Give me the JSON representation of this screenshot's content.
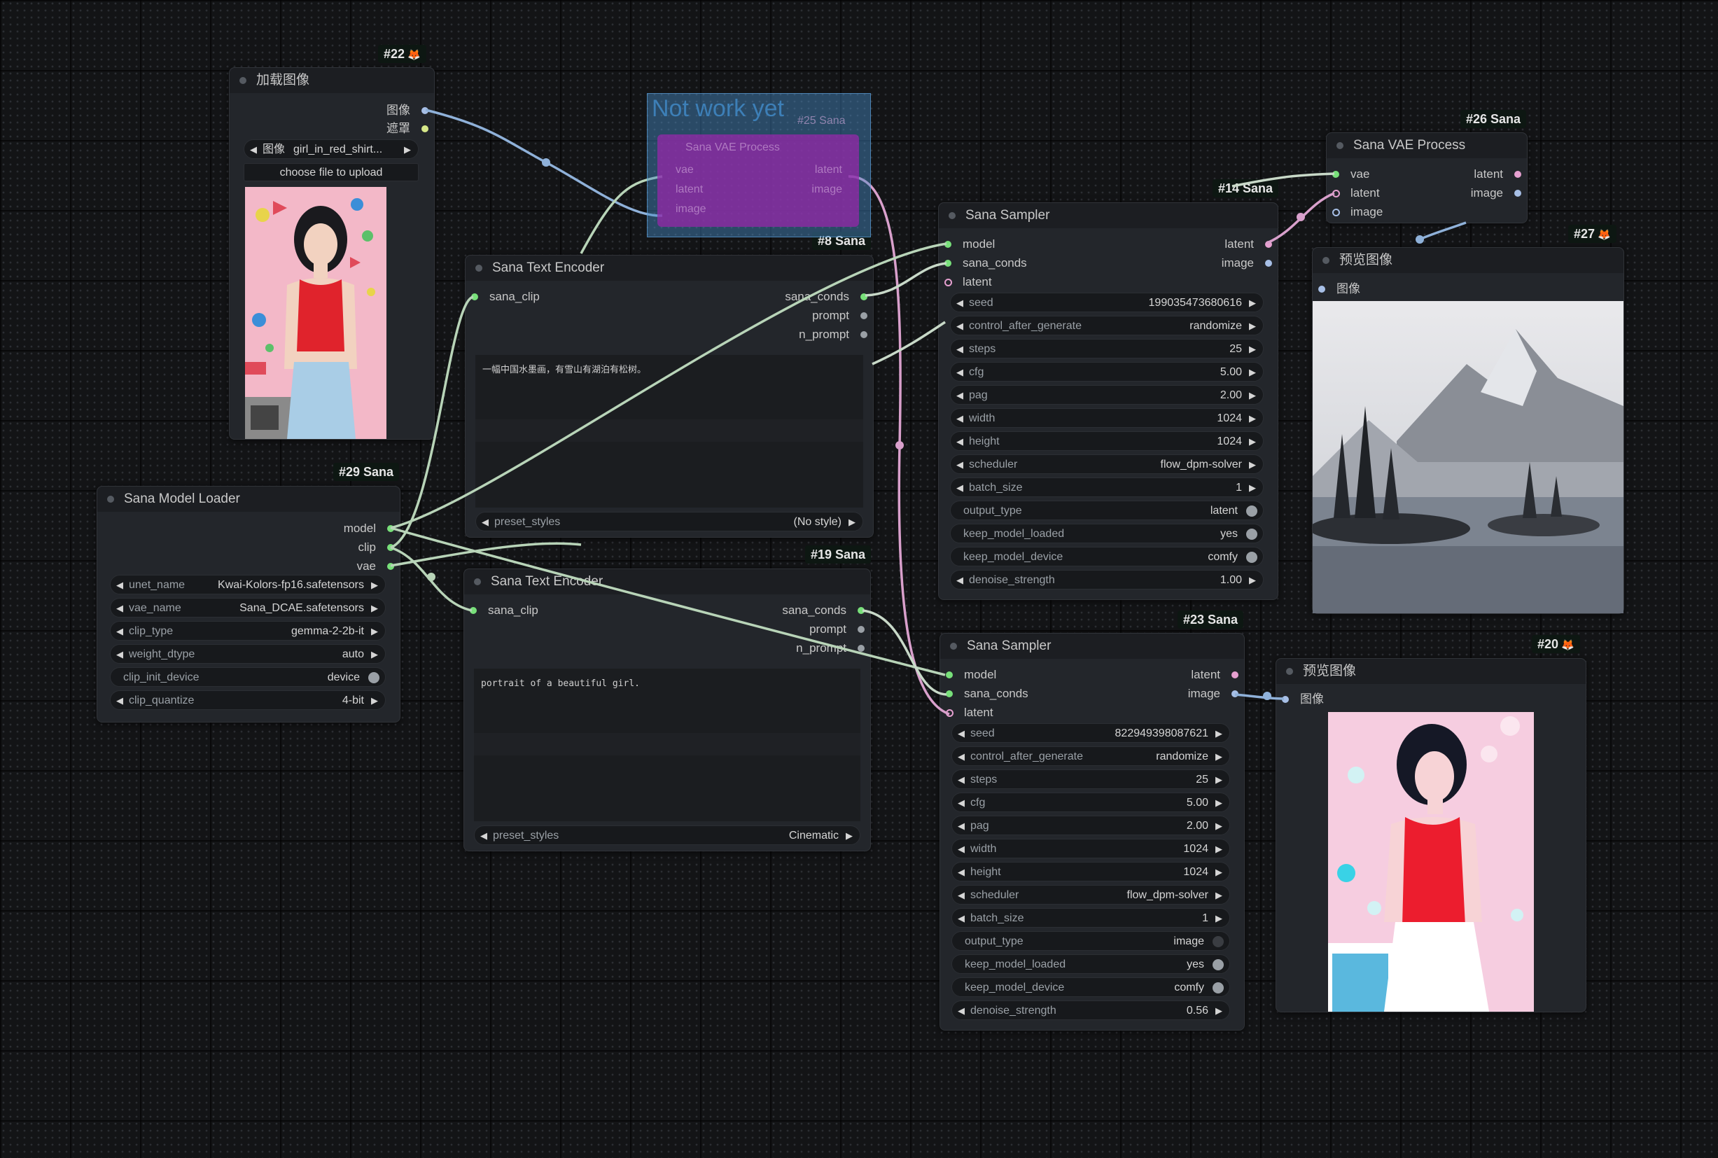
{
  "colors": {
    "clip_wire": "#b8d4b8",
    "vae_wire": "#f0e6e6",
    "image_wire": "#8fb1d9",
    "latent_wire": "#e6a0d0",
    "conds_wire": "#c8d9c8"
  },
  "icons": {
    "fox": "fox-icon",
    "arrow_left": "arrow-left-icon",
    "arrow_right": "arrow-right-icon"
  },
  "load_image": {
    "badge": "#22",
    "title": "加载图像",
    "outputs": [
      "图像",
      "遮罩"
    ],
    "image_widget": {
      "label": "图像",
      "value": "girl_in_red_shirt..."
    },
    "upload_button": "choose file to upload"
  },
  "group": {
    "title": "Not work yet",
    "badge": "#25 Sana",
    "node_title": "Sana VAE Process",
    "inputs": [
      "vae",
      "latent",
      "image"
    ],
    "outputs": [
      "latent",
      "image"
    ]
  },
  "text_encoder_1": {
    "badge": "#8 Sana",
    "title": "Sana Text Encoder",
    "input": "sana_clip",
    "outputs": [
      "sana_conds",
      "prompt",
      "n_prompt"
    ],
    "text": "一幅中国水墨画，有雪山有湖泊有松树。",
    "preset": {
      "label": "preset_styles",
      "value": "(No style)"
    }
  },
  "text_encoder_2": {
    "badge": "#19 Sana",
    "title": "Sana Text Encoder",
    "input": "sana_clip",
    "outputs": [
      "sana_conds",
      "prompt",
      "n_prompt"
    ],
    "text": "portrait of a beautiful girl.",
    "preset": {
      "label": "preset_styles",
      "value": "Cinematic"
    }
  },
  "model_loader": {
    "badge": "#29 Sana",
    "title": "Sana Model Loader",
    "outputs": [
      "model",
      "clip",
      "vae"
    ],
    "widgets": [
      {
        "label": "unet_name",
        "value": "Kwai-Kolors-fp16.safetensors",
        "kind": "combo"
      },
      {
        "label": "vae_name",
        "value": "Sana_DCAE.safetensors",
        "kind": "combo"
      },
      {
        "label": "clip_type",
        "value": "gemma-2-2b-it",
        "kind": "combo"
      },
      {
        "label": "weight_dtype",
        "value": "auto",
        "kind": "combo"
      },
      {
        "label": "clip_init_device",
        "value": "device",
        "kind": "toggle"
      },
      {
        "label": "clip_quantize",
        "value": "4-bit",
        "kind": "combo"
      }
    ]
  },
  "sampler_1": {
    "badge": "#14 Sana",
    "title": "Sana Sampler",
    "inputs": [
      "model",
      "sana_conds",
      "latent"
    ],
    "outputs": [
      "latent",
      "image"
    ],
    "widgets": [
      {
        "label": "seed",
        "value": "199035473680616",
        "kind": "num"
      },
      {
        "label": "control_after_generate",
        "value": "randomize",
        "kind": "num"
      },
      {
        "label": "steps",
        "value": "25",
        "kind": "num"
      },
      {
        "label": "cfg",
        "value": "5.00",
        "kind": "num"
      },
      {
        "label": "pag",
        "value": "2.00",
        "kind": "num"
      },
      {
        "label": "width",
        "value": "1024",
        "kind": "num"
      },
      {
        "label": "height",
        "value": "1024",
        "kind": "num"
      },
      {
        "label": "scheduler",
        "value": "flow_dpm-solver",
        "kind": "num"
      },
      {
        "label": "batch_size",
        "value": "1",
        "kind": "num"
      },
      {
        "label": "output_type",
        "value": "latent",
        "kind": "toggle"
      },
      {
        "label": "keep_model_loaded",
        "value": "yes",
        "kind": "toggle"
      },
      {
        "label": "keep_model_device",
        "value": "comfy",
        "kind": "toggle"
      },
      {
        "label": "denoise_strength",
        "value": "1.00",
        "kind": "num"
      }
    ]
  },
  "sampler_2": {
    "badge": "#23 Sana",
    "title": "Sana Sampler",
    "inputs": [
      "model",
      "sana_conds",
      "latent"
    ],
    "outputs": [
      "latent",
      "image"
    ],
    "widgets": [
      {
        "label": "seed",
        "value": "822949398087621",
        "kind": "num"
      },
      {
        "label": "control_after_generate",
        "value": "randomize",
        "kind": "num"
      },
      {
        "label": "steps",
        "value": "25",
        "kind": "num"
      },
      {
        "label": "cfg",
        "value": "5.00",
        "kind": "num"
      },
      {
        "label": "pag",
        "value": "2.00",
        "kind": "num"
      },
      {
        "label": "width",
        "value": "1024",
        "kind": "num"
      },
      {
        "label": "height",
        "value": "1024",
        "kind": "num"
      },
      {
        "label": "scheduler",
        "value": "flow_dpm-solver",
        "kind": "num"
      },
      {
        "label": "batch_size",
        "value": "1",
        "kind": "num"
      },
      {
        "label": "output_type",
        "value": "image",
        "kind": "toggle-off"
      },
      {
        "label": "keep_model_loaded",
        "value": "yes",
        "kind": "toggle"
      },
      {
        "label": "keep_model_device",
        "value": "comfy",
        "kind": "toggle"
      },
      {
        "label": "denoise_strength",
        "value": "0.56",
        "kind": "num"
      }
    ]
  },
  "vae_process": {
    "badge": "#26 Sana",
    "title": "Sana VAE Process",
    "inputs": [
      "vae",
      "latent",
      "image"
    ],
    "outputs": [
      "latent",
      "image"
    ]
  },
  "preview_1": {
    "badge": "#27",
    "title": "预览图像",
    "input": "图像"
  },
  "preview_2": {
    "badge": "#20",
    "title": "预览图像",
    "input": "图像"
  }
}
